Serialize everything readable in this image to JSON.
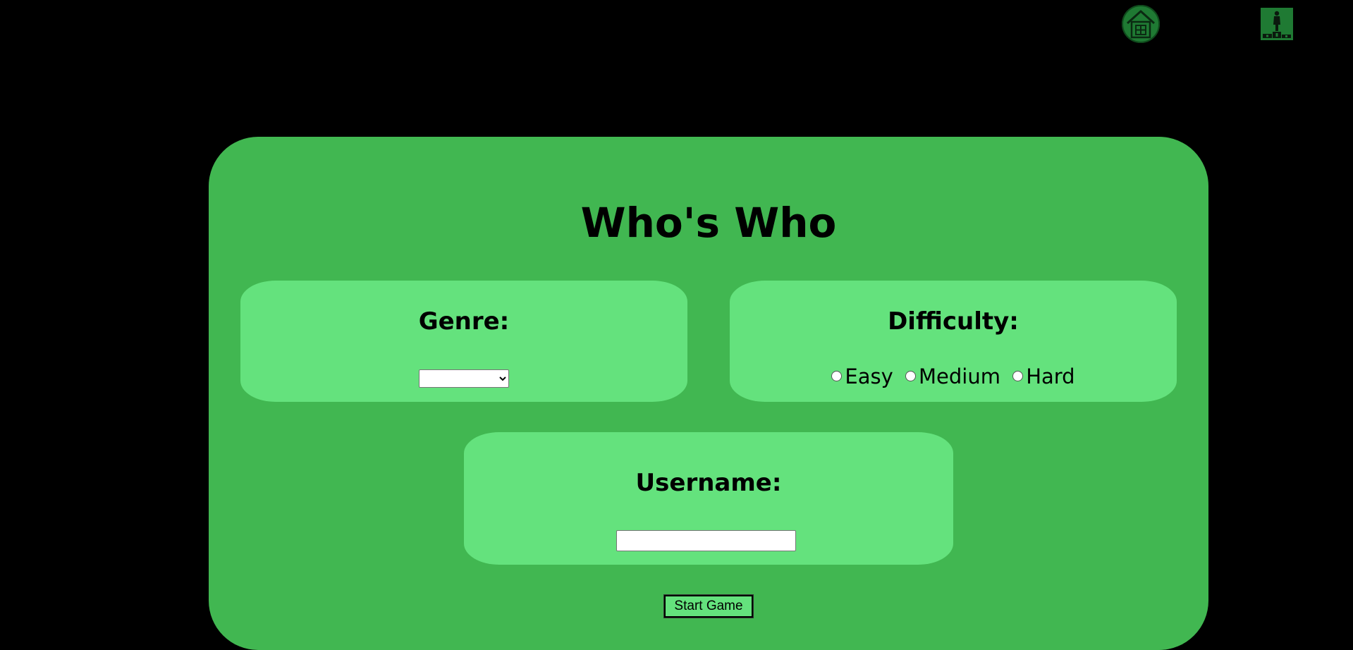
{
  "topbar": {
    "home_icon": "home-icon",
    "leaderboard_icon": "leaderboard-podium-icon"
  },
  "main": {
    "title": "Who's Who",
    "genre": {
      "heading": "Genre:",
      "selected_value": ""
    },
    "difficulty": {
      "heading": "Difficulty:",
      "options": [
        "Easy",
        "Medium",
        "Hard"
      ]
    },
    "username": {
      "heading": "Username:",
      "value": ""
    },
    "start_button_label": "Start Game"
  },
  "colors": {
    "background": "#000000",
    "card": "#41b751",
    "panel": "#64e27d",
    "icon_dark_green": "#1f7a33"
  }
}
